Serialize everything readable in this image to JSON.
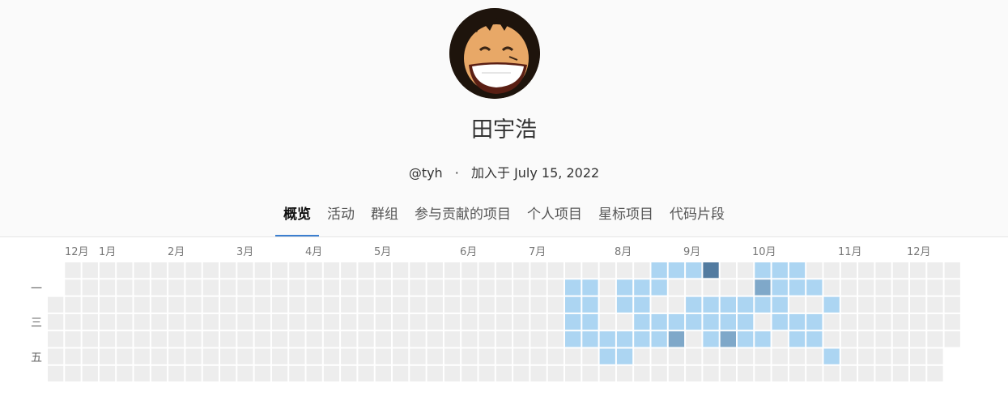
{
  "profile": {
    "name": "田宇浩",
    "handle": "@tyh",
    "separator": "·",
    "joined": "加入于 July 15, 2022"
  },
  "tabs": [
    {
      "label": "概览",
      "active": true
    },
    {
      "label": "活动",
      "active": false
    },
    {
      "label": "群组",
      "active": false
    },
    {
      "label": "参与贡献的项目",
      "active": false
    },
    {
      "label": "个人项目",
      "active": false
    },
    {
      "label": "星标项目",
      "active": false
    },
    {
      "label": "代码片段",
      "active": false
    }
  ],
  "calendar": {
    "months": [
      "12月",
      "1月",
      "2月",
      "3月",
      "4月",
      "5月",
      "6月",
      "7月",
      "8月",
      "9月",
      "10月",
      "11月",
      "12月"
    ],
    "day_labels": [
      "一",
      "三",
      "五"
    ],
    "colors": {
      "empty": "#ededed",
      "l1": "#acd5f2",
      "l2": "#7fa8c9",
      "l3": "#527ba0"
    },
    "active_cells": [
      {
        "w": 30,
        "d": 1,
        "l": 1
      },
      {
        "w": 30,
        "d": 2,
        "l": 1
      },
      {
        "w": 30,
        "d": 3,
        "l": 1
      },
      {
        "w": 30,
        "d": 4,
        "l": 1
      },
      {
        "w": 31,
        "d": 1,
        "l": 1
      },
      {
        "w": 31,
        "d": 2,
        "l": 1
      },
      {
        "w": 31,
        "d": 3,
        "l": 1
      },
      {
        "w": 31,
        "d": 4,
        "l": 1
      },
      {
        "w": 32,
        "d": 4,
        "l": 1
      },
      {
        "w": 32,
        "d": 5,
        "l": 1
      },
      {
        "w": 33,
        "d": 1,
        "l": 1
      },
      {
        "w": 33,
        "d": 2,
        "l": 1
      },
      {
        "w": 33,
        "d": 4,
        "l": 1
      },
      {
        "w": 33,
        "d": 5,
        "l": 1
      },
      {
        "w": 34,
        "d": 1,
        "l": 1
      },
      {
        "w": 34,
        "d": 2,
        "l": 1
      },
      {
        "w": 34,
        "d": 3,
        "l": 1
      },
      {
        "w": 34,
        "d": 4,
        "l": 1
      },
      {
        "w": 35,
        "d": 0,
        "l": 1
      },
      {
        "w": 35,
        "d": 1,
        "l": 1
      },
      {
        "w": 35,
        "d": 3,
        "l": 1
      },
      {
        "w": 35,
        "d": 4,
        "l": 1
      },
      {
        "w": 36,
        "d": 0,
        "l": 1
      },
      {
        "w": 36,
        "d": 3,
        "l": 1
      },
      {
        "w": 36,
        "d": 4,
        "l": 2
      },
      {
        "w": 37,
        "d": 0,
        "l": 1
      },
      {
        "w": 37,
        "d": 2,
        "l": 1
      },
      {
        "w": 37,
        "d": 3,
        "l": 1
      },
      {
        "w": 38,
        "d": 0,
        "l": 3
      },
      {
        "w": 38,
        "d": 2,
        "l": 1
      },
      {
        "w": 38,
        "d": 3,
        "l": 1
      },
      {
        "w": 38,
        "d": 4,
        "l": 1
      },
      {
        "w": 39,
        "d": 2,
        "l": 1
      },
      {
        "w": 39,
        "d": 3,
        "l": 1
      },
      {
        "w": 39,
        "d": 4,
        "l": 2
      },
      {
        "w": 40,
        "d": 2,
        "l": 1
      },
      {
        "w": 40,
        "d": 3,
        "l": 1
      },
      {
        "w": 40,
        "d": 4,
        "l": 1
      },
      {
        "w": 41,
        "d": 0,
        "l": 1
      },
      {
        "w": 41,
        "d": 1,
        "l": 2
      },
      {
        "w": 41,
        "d": 2,
        "l": 1
      },
      {
        "w": 41,
        "d": 4,
        "l": 1
      },
      {
        "w": 42,
        "d": 0,
        "l": 1
      },
      {
        "w": 42,
        "d": 1,
        "l": 1
      },
      {
        "w": 42,
        "d": 2,
        "l": 1
      },
      {
        "w": 42,
        "d": 3,
        "l": 1
      },
      {
        "w": 43,
        "d": 0,
        "l": 1
      },
      {
        "w": 43,
        "d": 1,
        "l": 1
      },
      {
        "w": 43,
        "d": 3,
        "l": 1
      },
      {
        "w": 43,
        "d": 4,
        "l": 1
      },
      {
        "w": 44,
        "d": 1,
        "l": 1
      },
      {
        "w": 44,
        "d": 3,
        "l": 1
      },
      {
        "w": 44,
        "d": 4,
        "l": 1
      },
      {
        "w": 45,
        "d": 2,
        "l": 1
      },
      {
        "w": 45,
        "d": 5,
        "l": 1
      }
    ]
  }
}
